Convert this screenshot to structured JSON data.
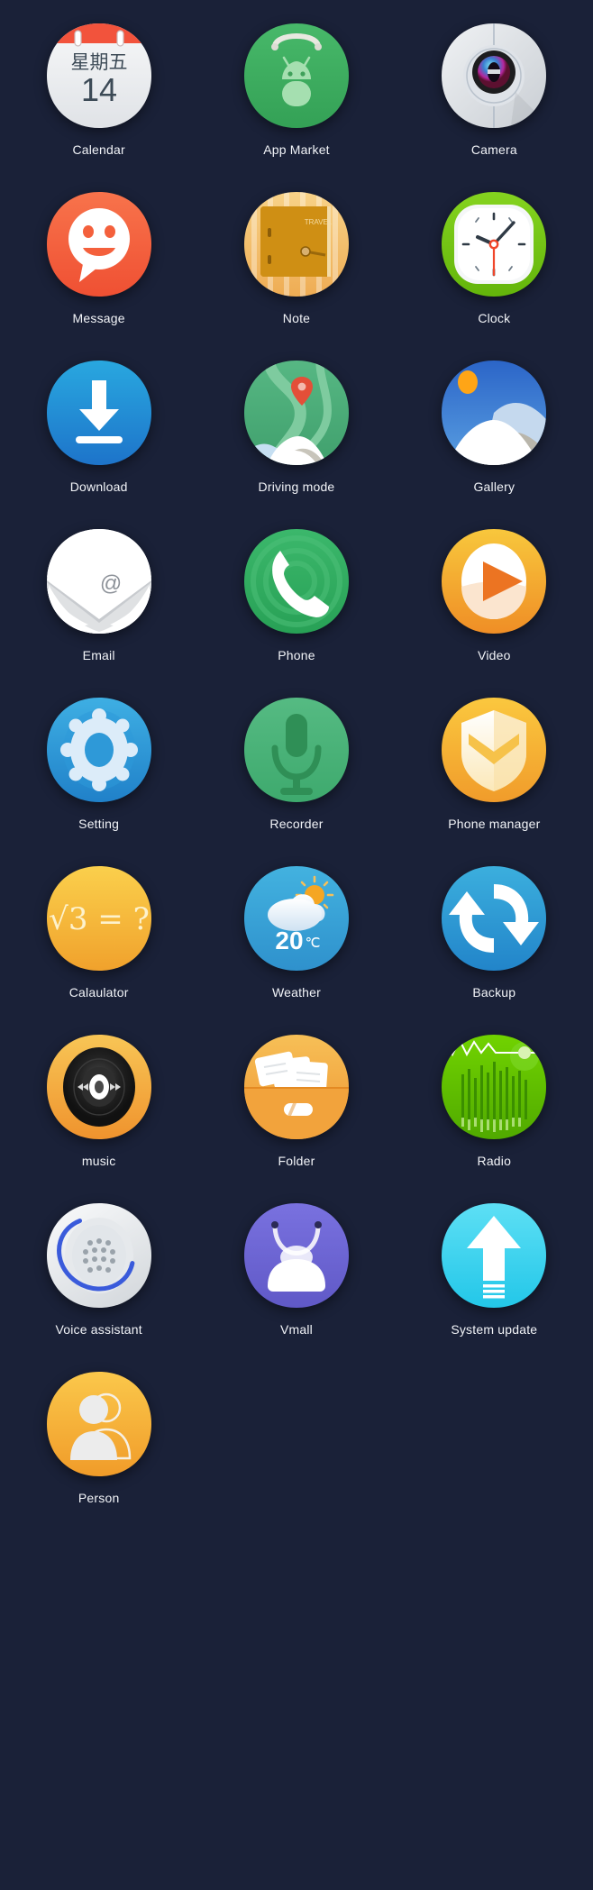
{
  "screen": {
    "type": "app-icon-set",
    "background_color": "#1a2138",
    "label_color": "#f2f4f8",
    "columns": 3,
    "rows": 9,
    "total_apps": 25
  },
  "apps": [
    {
      "id": "calendar",
      "label": "Calendar",
      "icon": "calendar-icon",
      "colors": {
        "top": "#f2533c",
        "body": "#eceef0"
      },
      "glyph_text": {
        "weekday": "星期五",
        "day": "14"
      }
    },
    {
      "id": "app-market",
      "label": "App Market",
      "icon": "app-market-icon",
      "colors": {
        "primary": "#3fae5f",
        "accent": "#8ed79c"
      }
    },
    {
      "id": "camera",
      "label": "Camera",
      "icon": "camera-icon",
      "colors": {
        "primary": "#d7dbe0",
        "lens": "#c0349a"
      }
    },
    {
      "id": "message",
      "label": "Message",
      "icon": "message-icon",
      "colors": {
        "primary": "#f4643f",
        "bubble": "#ffffff"
      }
    },
    {
      "id": "note",
      "label": "Note",
      "icon": "note-icon",
      "colors": {
        "primary": "#f5c86b",
        "door": "#c78418"
      },
      "glyph_text": {
        "plate": "TRAVEL"
      }
    },
    {
      "id": "clock",
      "label": "Clock",
      "icon": "clock-icon",
      "colors": {
        "primary": "#78c819",
        "face": "#ffffff",
        "second_hand": "#f0462a"
      }
    },
    {
      "id": "download",
      "label": "Download",
      "icon": "download-icon",
      "colors": {
        "primary": "#1f8fd4",
        "arrow": "#ffffff"
      }
    },
    {
      "id": "driving-mode",
      "label": "Driving mode",
      "icon": "driving-mode-icon",
      "colors": {
        "primary": "#4cb07a",
        "pin": "#e8513a"
      }
    },
    {
      "id": "gallery",
      "label": "Gallery",
      "icon": "gallery-icon",
      "colors": {
        "sky": "#2f6fd0",
        "sun": "#ffa516",
        "snow": "#ffffff"
      }
    },
    {
      "id": "email",
      "label": "Email",
      "icon": "email-icon",
      "colors": {
        "primary": "#ffffff",
        "at": "#8d9299"
      },
      "glyph_text": {
        "at": "@"
      }
    },
    {
      "id": "phone",
      "label": "Phone",
      "icon": "phone-icon",
      "colors": {
        "primary": "#2fa95c",
        "handset": "#ffffff"
      }
    },
    {
      "id": "video",
      "label": "Video",
      "icon": "video-icon",
      "colors": {
        "primary": "#f2a627",
        "play": "#ed7522"
      }
    },
    {
      "id": "setting",
      "label": "Setting",
      "icon": "setting-gear-icon",
      "colors": {
        "primary": "#2a9cdd",
        "gear": "#d9ecfa"
      }
    },
    {
      "id": "recorder",
      "label": "Recorder",
      "icon": "recorder-mic-icon",
      "colors": {
        "primary": "#4cb478",
        "mic": "#2f8f56"
      }
    },
    {
      "id": "phone-manager",
      "label": "Phone manager",
      "icon": "shield-icon",
      "colors": {
        "primary": "#f5b731",
        "shield": "#fdf6e2"
      }
    },
    {
      "id": "calculator",
      "label": "Calaulator",
      "icon": "calculator-icon",
      "colors": {
        "primary": "#f6c councils"
      },
      "glyph_text": {
        "expression": "√3 = ?"
      }
    },
    {
      "id": "weather",
      "label": "Weather",
      "icon": "weather-icon",
      "colors": {
        "primary": "#36a3d8",
        "cloud": "#ffffff",
        "sun": "#f5a623"
      },
      "glyph_text": {
        "temperature": "20",
        "unit": "℃"
      }
    },
    {
      "id": "backup",
      "label": "Backup",
      "icon": "backup-sync-icon",
      "colors": {
        "primary": "#2e9fd6",
        "arrows": "#ffffff"
      }
    },
    {
      "id": "music",
      "label": "music",
      "icon": "music-disc-icon",
      "colors": {
        "primary": "#f2a936",
        "disc": "#2a2a2a"
      }
    },
    {
      "id": "folder",
      "label": "Folder",
      "icon": "folder-icon",
      "colors": {
        "primary": "#f0a33a",
        "papers": "#ffffff"
      }
    },
    {
      "id": "radio",
      "label": "Radio",
      "icon": "radio-icon",
      "colors": {
        "primary": "#62c400",
        "wave": "#ffffff"
      }
    },
    {
      "id": "voice-assistant",
      "label": "Voice  assistant",
      "icon": "voice-assistant-icon",
      "colors": {
        "primary": "#e9ecef",
        "ring": "#3a5bdb"
      }
    },
    {
      "id": "vmall",
      "label": "Vmall",
      "icon": "vmall-bag-icon",
      "colors": {
        "primary": "#6a63d4",
        "bag": "#ffffff"
      }
    },
    {
      "id": "system-update",
      "label": "System update",
      "icon": "system-update-icon",
      "colors": {
        "primary": "#3fd0f0",
        "arrow": "#ffffff"
      }
    },
    {
      "id": "person",
      "label": "Person",
      "icon": "person-icon",
      "colors": {
        "primary": "#f6b429",
        "figure": "#ececec"
      }
    }
  ]
}
